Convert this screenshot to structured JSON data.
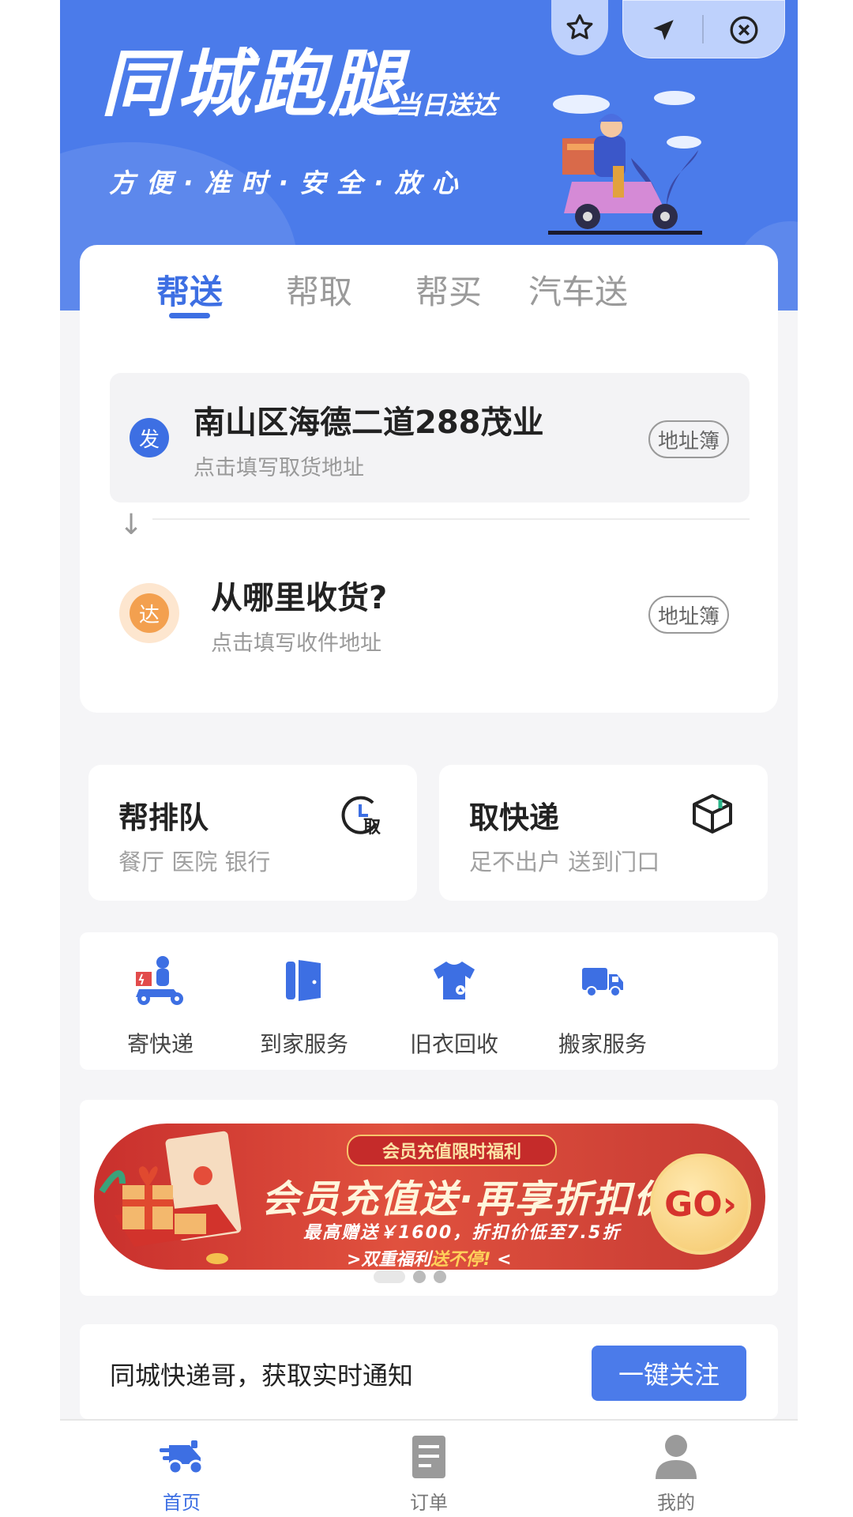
{
  "hero": {
    "title": "同城跑腿",
    "tag": "当日送达",
    "slogan": "方便·准时·安全·放心"
  },
  "tabs": [
    {
      "label": "帮送",
      "active": true
    },
    {
      "label": "帮取",
      "active": false
    },
    {
      "label": "帮买",
      "active": false
    },
    {
      "label": "汽车送",
      "active": false
    }
  ],
  "pickup": {
    "badge": "发",
    "address": "南山区海德二道288茂业",
    "hint": "点击填写取货地址",
    "book_label": "地址簿"
  },
  "dropoff": {
    "badge": "达",
    "address": "从哪里收货?",
    "hint": "点击填写收件地址",
    "book_label": "地址簿"
  },
  "quick": [
    {
      "title": "帮排队",
      "subtitle": "餐厅 医院 银行",
      "icon": "queue-clock-icon",
      "icon_text": "取"
    },
    {
      "title": "取快递",
      "subtitle": "足不出户 送到门口",
      "icon": "package-box-icon"
    }
  ],
  "services": [
    {
      "label": "寄快递",
      "icon": "courier-scooter-icon"
    },
    {
      "label": "到家服务",
      "icon": "door-icon"
    },
    {
      "label": "旧衣回收",
      "icon": "tshirt-icon"
    },
    {
      "label": "搬家服务",
      "icon": "truck-icon"
    }
  ],
  "promo": {
    "pill": "会员充值限时福利",
    "headline": "会员充值送·再享折扣价",
    "detail": "最高赠送￥1600，折扣价低至7.5折",
    "tail_pre": ">双重福利",
    "tail_hl": "送不停!",
    "tail_post": "<",
    "go": "GO›"
  },
  "follow": {
    "text": "同城快递哥，获取实时通知",
    "button": "一键关注"
  },
  "nav": [
    {
      "label": "首页",
      "icon": "home-scooter-icon",
      "active": true
    },
    {
      "label": "订单",
      "icon": "order-doc-icon",
      "active": false
    },
    {
      "label": "我的",
      "icon": "profile-person-icon",
      "active": false
    }
  ],
  "colors": {
    "primary": "#3d6fe3",
    "hero_bg": "#4b7bea",
    "pickup_badge": "#3d6fe3",
    "drop_badge": "#f3a04f",
    "promo_red": "#c9302d"
  }
}
